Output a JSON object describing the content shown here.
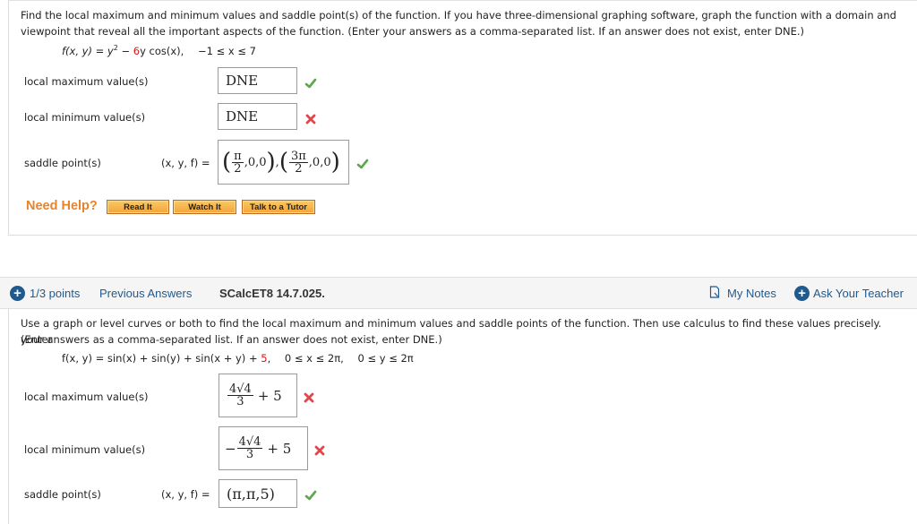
{
  "question1": {
    "prompt_line1": "Find the local maximum and minimum values and saddle point(s) of the function. If you have three-dimensional graphing software, graph the function with a domain and",
    "prompt_line2": "viewpoint that reveal all the important aspects of the function. (Enter your answers as a comma-separated list. If an answer does not exist, enter DNE.)",
    "formula": {
      "lhs": "f(x, y) = y",
      "exp": "2",
      "minus": " − ",
      "coef": "6",
      "rest": "y cos(x),",
      "domain": "−1 ≤ x ≤ 7"
    },
    "rows": [
      {
        "label": "local maximum value(s)",
        "answer": "DNE",
        "status": "correct"
      },
      {
        "label": "local minimum value(s)",
        "answer": "DNE",
        "status": "incorrect"
      },
      {
        "label": "saddle point(s)",
        "prefix": "(x, y, f) =",
        "answer": "(π/2,0,0),(3π/2,0,0)",
        "status": "correct",
        "parts": {
          "pi": "π",
          "two": "2",
          "threepi": "3π",
          "tail": ",0,0",
          "sep": ","
        }
      }
    ],
    "help": {
      "label": "Need Help?",
      "buttons": [
        "Read It",
        "Watch It",
        "Talk to a Tutor"
      ]
    }
  },
  "question2": {
    "header": {
      "points": "1/3 points",
      "previous": "Previous Answers",
      "code": "SCalcET8 14.7.025.",
      "notes": "My Notes",
      "ask": "Ask Your Teacher"
    },
    "prompt_line1": "Use a graph or level curves or both to find the local maximum and minimum values and saddle points of the function. Then use calculus to find these values precisely. (Enter",
    "prompt_line2": "your answers as a comma-separated list. If an answer does not exist, enter DNE.)",
    "formula": {
      "lhs": "f(x, y) = sin(x) + sin(y) + sin(x + y) + ",
      "const": "5",
      "comma": ",",
      "dx": "0 ≤ x ≤ 2π,",
      "dy": "0 ≤ y ≤ 2π"
    },
    "rows": [
      {
        "label": "local maximum value(s)",
        "answer": "4√4/3 + 5",
        "status": "incorrect",
        "num": "4√4",
        "den": "3",
        "plus": "+ 5"
      },
      {
        "label": "local minimum value(s)",
        "answer": "−4√4/3 + 5",
        "status": "incorrect",
        "neg": "−",
        "num": "4√4",
        "den": "3",
        "plus": "+ 5"
      },
      {
        "label": "saddle point(s)",
        "prefix": "(x, y, f) =",
        "answer": "(π,π,5)",
        "status": "correct"
      }
    ]
  },
  "colors": {
    "correct": "#5aa84a",
    "incorrect": "#e0464c",
    "link": "#1f5a8f",
    "help": "#e8832a"
  }
}
